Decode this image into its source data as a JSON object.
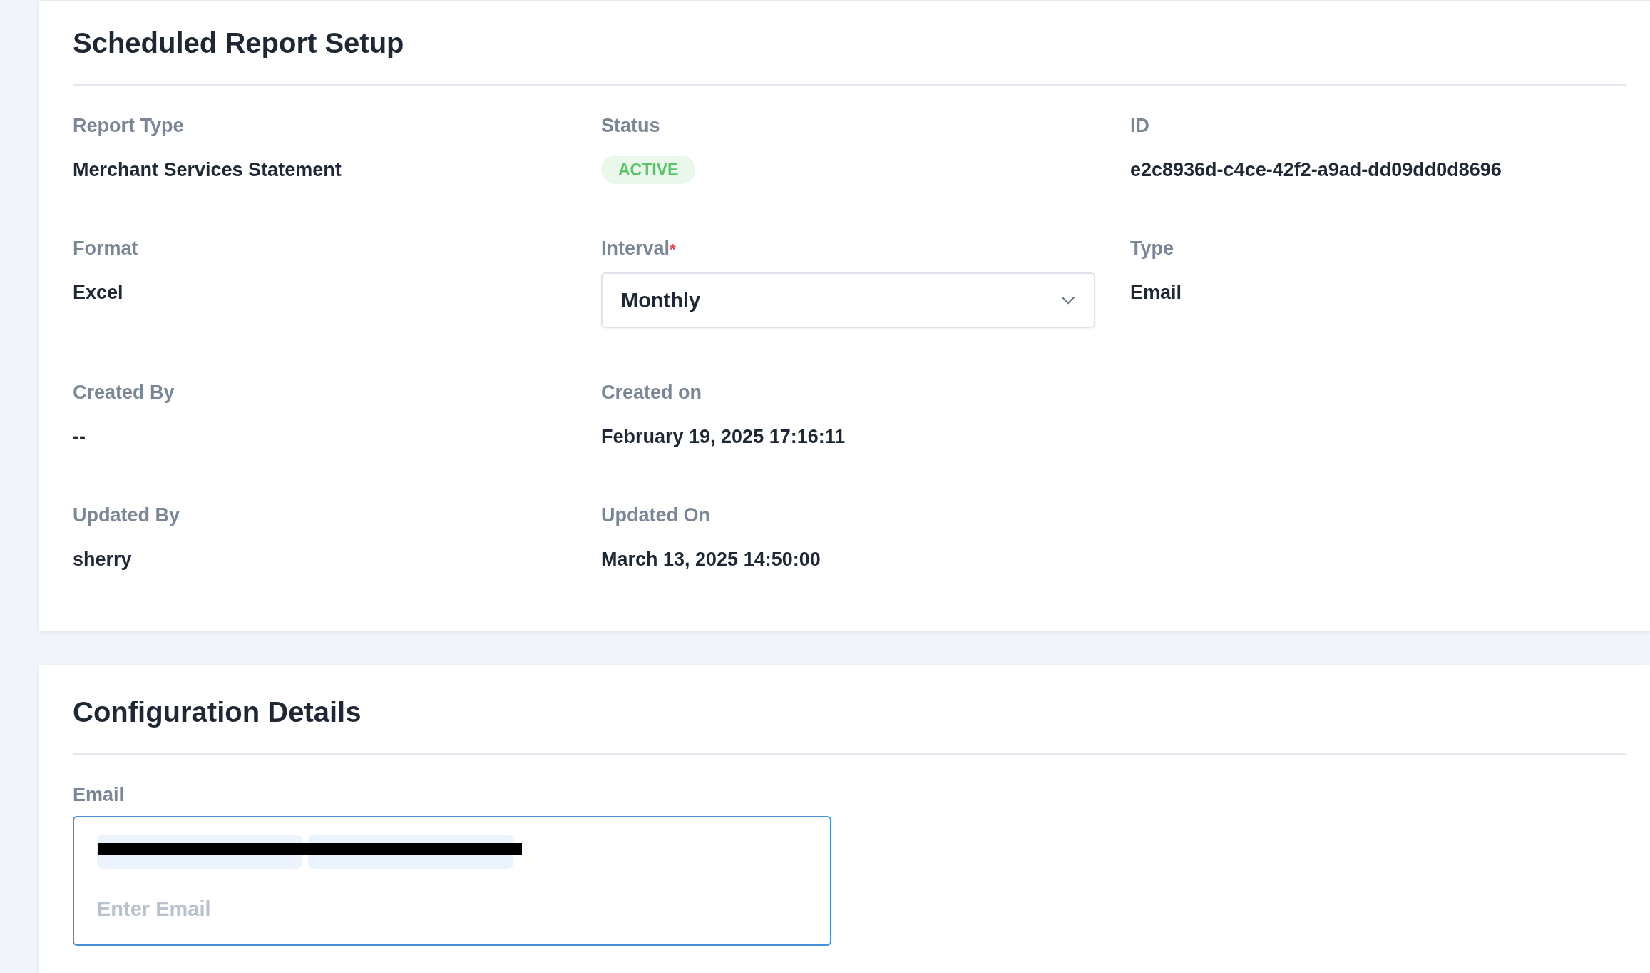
{
  "report_card": {
    "title": "Scheduled Report Setup",
    "fields": [
      {
        "kind": "text",
        "label": "Report Type",
        "value": "Merchant Services Statement"
      },
      {
        "kind": "status",
        "label": "Status",
        "value": "ACTIVE"
      },
      {
        "kind": "text",
        "label": "ID",
        "value": "e2c8936d-c4ce-42f2-a9ad-dd09dd0d8696"
      },
      {
        "kind": "text",
        "label": "Format",
        "value": "Excel"
      },
      {
        "kind": "select",
        "label": "Interval",
        "required_mark": "*",
        "value": "Monthly"
      },
      {
        "kind": "text",
        "label": "Type",
        "value": "Email"
      },
      {
        "kind": "text",
        "label": "Created By",
        "value": "--"
      },
      {
        "kind": "text",
        "label": "Created on",
        "value": "February 19, 2025 17:16:11"
      },
      {
        "kind": "empty"
      },
      {
        "kind": "text",
        "label": "Updated By",
        "value": "sherry"
      },
      {
        "kind": "text",
        "label": "Updated On",
        "value": "March 13, 2025 14:50:00"
      }
    ]
  },
  "config_card": {
    "title": "Configuration Details",
    "email": {
      "label": "Email",
      "placeholder": "Enter Email",
      "chips": [
        {
          "kind": "redacted"
        },
        {
          "kind": "redacted"
        }
      ]
    }
  }
}
